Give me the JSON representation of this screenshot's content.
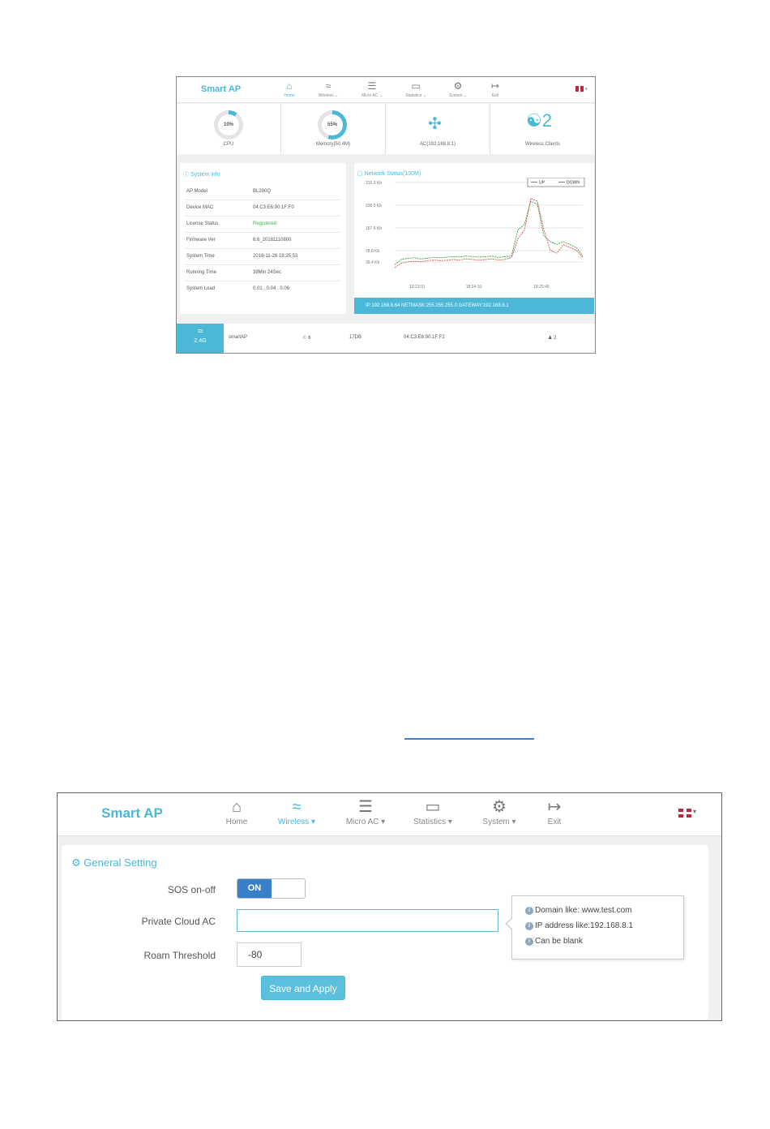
{
  "screen1": {
    "logo": "Smart AP",
    "nav": [
      {
        "label": "Home",
        "icon": "home-icon"
      },
      {
        "label": "Wireless ⌄",
        "icon": "wifi-icon"
      },
      {
        "label": "Micro AC ⌄",
        "icon": "sliders-icon"
      },
      {
        "label": "Statistics ⌄",
        "icon": "monitor-icon"
      },
      {
        "label": "System ⌄",
        "icon": "gear-icon"
      },
      {
        "label": "Exit",
        "icon": "exit-icon"
      }
    ],
    "stats": {
      "cpu_value": "10%",
      "cpu_label": "CPU",
      "cpu_fraction": 0.1,
      "memory_value": "55%",
      "memory_label": "Memory(50.4M)",
      "memory_fraction": 0.55,
      "ac_label": "AC(192.168.8.1)",
      "clients_count": "2",
      "clients_label": "Wireless Clients"
    },
    "system_info": {
      "title": "System info",
      "rows": [
        {
          "key": "AP Model",
          "value": "BL200Q"
        },
        {
          "key": "Device MAC",
          "value": "04:C3:E6:90:1F:F0"
        },
        {
          "key": "License Status",
          "value": "Registered"
        },
        {
          "key": "Firmware Ver",
          "value": "6.6_20181110800"
        },
        {
          "key": "System Time",
          "value": "2018-11-28 18:25:53"
        },
        {
          "key": "Running Time",
          "value": "39Min 24Sec"
        },
        {
          "key": "System Load",
          "value": "0.01 , 0.04 , 0.06"
        }
      ]
    },
    "network_status": {
      "title": "Network Status(100M)",
      "footer": "IP:192.168.8.64  NETMASK:255.255.255.0  GATEWAY:192.168.8.1"
    },
    "chart_data": {
      "type": "line",
      "title": "",
      "y_ticks": [
        "315.3 Kb",
        "236.5 Kb",
        "157.6 Kb",
        "78.8 Kb",
        "39.4 Kb"
      ],
      "x_ticks": [
        "18:23:01",
        "18:24:10",
        "18:25:45"
      ],
      "legend": [
        "UP",
        "DOWN"
      ],
      "legend_position": "top-right",
      "grid": true,
      "x": [
        0,
        1,
        2,
        3,
        4,
        5,
        6,
        7,
        8,
        9,
        10,
        11,
        12,
        13,
        14,
        15,
        16,
        17,
        18,
        19,
        20,
        21,
        22,
        23,
        24,
        25,
        26,
        27,
        28,
        29
      ],
      "series": [
        {
          "name": "UP",
          "color": "#3a9d3a",
          "values": [
            30,
            48,
            52,
            54,
            50,
            52,
            55,
            54,
            56,
            58,
            57,
            60,
            58,
            56,
            58,
            60,
            55,
            58,
            60,
            150,
            170,
            250,
            240,
            130,
            110,
            100,
            110,
            100,
            90,
            60
          ]
        },
        {
          "name": "DOWN",
          "color": "#d9534f",
          "values": [
            20,
            35,
            40,
            42,
            40,
            44,
            46,
            44,
            45,
            48,
            46,
            50,
            48,
            46,
            48,
            50,
            46,
            48,
            55,
            120,
            150,
            260,
            250,
            150,
            80,
            70,
            100,
            90,
            80,
            55
          ]
        }
      ]
    },
    "bottom": {
      "band": "2.4G",
      "ssid": "smartAP",
      "channel": "6",
      "power": "17DB",
      "mac": "04:C3:E6:90:1F:F2",
      "clients": "2"
    }
  },
  "screen2": {
    "logo": "Smart AP",
    "nav": [
      {
        "label": "Home",
        "icon": "home-icon"
      },
      {
        "label": "Wireless ▾",
        "icon": "wifi-icon"
      },
      {
        "label": "Micro AC ▾",
        "icon": "sliders-icon"
      },
      {
        "label": "Statistics ▾",
        "icon": "monitor-icon"
      },
      {
        "label": "System ▾",
        "icon": "gear-icon"
      },
      {
        "label": "Exit",
        "icon": "exit-icon"
      }
    ],
    "panel_title": "General Setting",
    "sos_label": "SOS on-off",
    "sos_value": "ON",
    "cloud_label": "Private Cloud AC",
    "cloud_value": "",
    "roam_label": "Roam Threshold",
    "roam_value": "-80",
    "save_label": "Save and Apply",
    "tips": [
      "Domain like: www.test.com",
      "IP address like:192.168.8.1",
      "Can be blank"
    ]
  }
}
